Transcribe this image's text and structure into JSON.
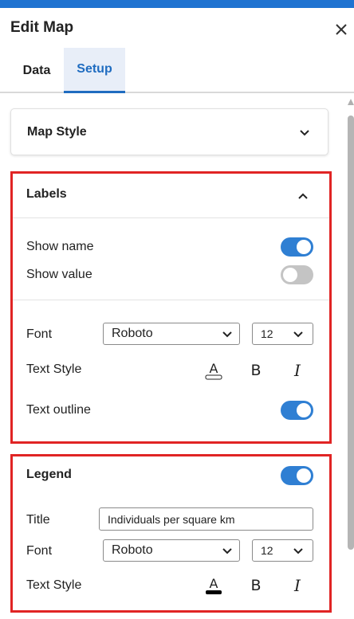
{
  "header": {
    "title": "Edit Map",
    "close_icon": "close-icon"
  },
  "tabs": [
    {
      "label": "Data",
      "active": false
    },
    {
      "label": "Setup",
      "active": true
    }
  ],
  "map_style": {
    "title": "Map Style",
    "expanded": false
  },
  "labels": {
    "title": "Labels",
    "expanded": true,
    "show_name": {
      "label": "Show name",
      "on": true
    },
    "show_value": {
      "label": "Show value",
      "on": false
    },
    "font": {
      "label": "Font",
      "value": "Roboto",
      "size": "12"
    },
    "text_style": {
      "label": "Text Style",
      "icons": [
        "text-color-icon",
        "bold-icon",
        "italic-icon"
      ],
      "bold_glyph": "B",
      "italic_glyph": "I",
      "color_glyph": "A",
      "color": "#ffffff"
    },
    "text_outline": {
      "label": "Text outline",
      "on": true
    }
  },
  "legend": {
    "title": "Legend",
    "on": true,
    "title_field": {
      "label": "Title",
      "value": "Individuals per square km"
    },
    "font": {
      "label": "Font",
      "value": "Roboto",
      "size": "12"
    },
    "text_style": {
      "label": "Text Style",
      "icons": [
        "text-color-icon",
        "bold-icon",
        "italic-icon"
      ],
      "bold_glyph": "B",
      "italic_glyph": "I",
      "color_glyph": "A",
      "color": "#000000"
    }
  },
  "colors": {
    "accent": "#1f73d1",
    "toggle_on": "#2f7fd3",
    "toggle_off": "#c4c4c4",
    "highlight_border": "#e02424"
  }
}
